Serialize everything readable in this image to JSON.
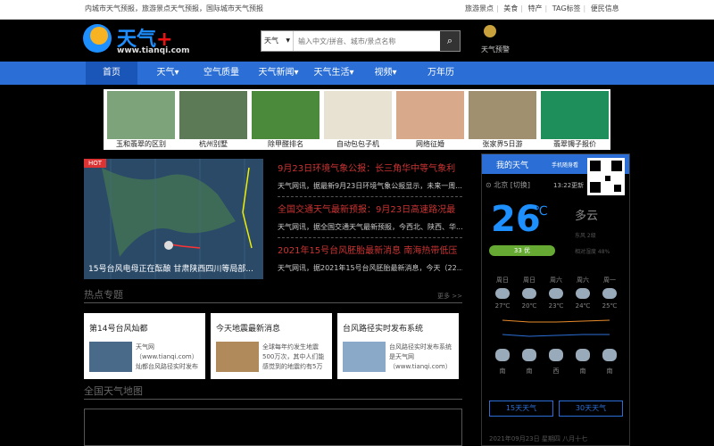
{
  "topbar": {
    "intro": "内城市天气预报，旅游景点天气预报，国际城市天气预报",
    "links": [
      "旅游景点",
      "美食",
      "特产",
      "TAG标签",
      "便民信息"
    ]
  },
  "logo": {
    "name": "天气",
    "plus": "+",
    "url": "www.tianqi.com"
  },
  "search": {
    "select": "天气",
    "placeholder": "输入中文/拼音、城市/景点名称"
  },
  "alert": {
    "label": "天气预警"
  },
  "nav": [
    "首页",
    "天气▾",
    "空气质量",
    "天气新闻▾",
    "天气生活▾",
    "视频▾",
    "万年历"
  ],
  "banner": [
    "玉和翡翠的区别",
    "杭州别墅",
    "除甲醛排名",
    "自动包包子机",
    "网络征婚",
    "张家界5日游",
    "翡翠镯子报价"
  ],
  "hero": {
    "badge": "HOT",
    "caption": "15号台风电母正在酝酿 甘肃陕西四川等局部..."
  },
  "news": [
    {
      "title": "9月23日环境气象公报：长三角华中等气象利",
      "desc": "天气网讯，据最新9月23日环境气象公报显示，未来一周..."
    },
    {
      "title": "全国交通天气最新预报：9月23日高速路况最",
      "desc": "天气网讯，据全国交通天气最新预报，今西北、陕西、华..."
    },
    {
      "title": "2021年15号台风胚胎最新消息 南海热带低压",
      "desc": "天气网讯，据2021年15号台风胚胎最新消息，今天（22..."
    }
  ],
  "topics": {
    "title": "热点专题",
    "more": "更多 >>"
  },
  "cards": [
    {
      "title": "第14号台风灿都",
      "desc": "天气网（www.tianqi.com）灿都台风路径实时发布"
    },
    {
      "title": "今天地震最新消息",
      "desc": "全球每年约发生地震500万次，其中人们能感觉到的地震约有5万"
    },
    {
      "title": "台风路径实时发布系统",
      "desc": "台风路径实时发布系统是天气网（www.tianqi.com）"
    }
  ],
  "map": {
    "title": "全国天气地图"
  },
  "myweather": {
    "title": "我的天气",
    "sub": "手机随身看",
    "city": "北京",
    "switch": "[切换]",
    "updated": "13:22更新",
    "temp": "26",
    "unit": "℃",
    "cond": "多云",
    "aqi": "33 优",
    "wind": "东风 2级",
    "humidity": "相对湿度 48%"
  },
  "forecast": [
    {
      "d": "周日",
      "t": "27℃"
    },
    {
      "d": "周日",
      "t": "20℃"
    },
    {
      "d": "周六",
      "t": "23℃"
    },
    {
      "d": "周六",
      "t": "24℃"
    },
    {
      "d": "周一",
      "t": "25℃"
    }
  ],
  "forecast_night": [
    "南",
    "南",
    "西",
    "南",
    "南"
  ],
  "buttons": {
    "d15": "15天天气",
    "d30": "30天天气"
  },
  "date": "2021年09月23日 星期四 八月十七"
}
